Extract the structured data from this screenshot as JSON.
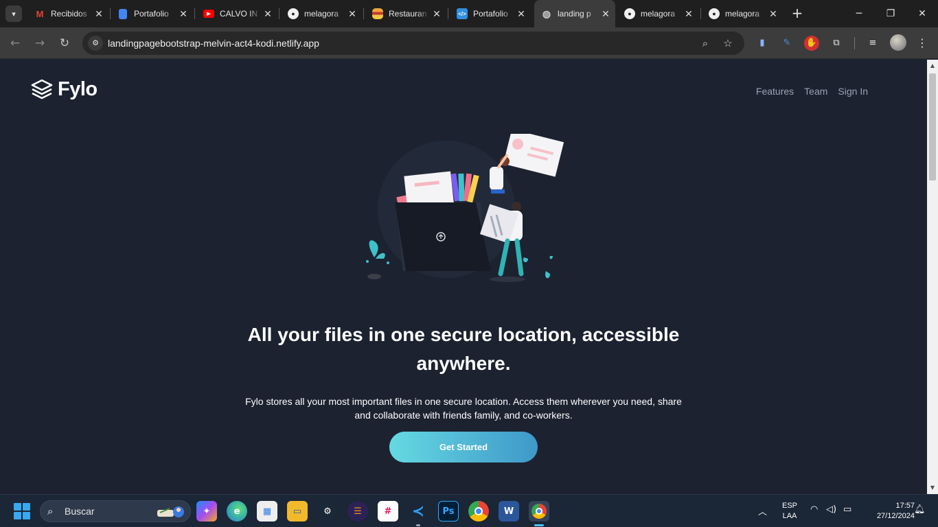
{
  "browser": {
    "tabs": [
      {
        "title": "Recibidos",
        "icon": "gmail-icon"
      },
      {
        "title": "Portafolio",
        "icon": "docs-icon"
      },
      {
        "title": "CALVO IN",
        "icon": "youtube-icon"
      },
      {
        "title": "melagora",
        "icon": "github-icon"
      },
      {
        "title": "Restauran",
        "icon": "burger-icon"
      },
      {
        "title": "Portafolio",
        "icon": "code-icon"
      },
      {
        "title": "landing p",
        "icon": "globe-icon",
        "active": true
      },
      {
        "title": "melagora",
        "icon": "github-icon"
      },
      {
        "title": "melagora",
        "icon": "github-icon"
      }
    ],
    "url": "landingpagebootstrap-melvin-act4-kodi.netlify.app",
    "colors": {
      "tabstrip": "#1f1f1f",
      "toolbar": "#3c3c3c",
      "omnibox": "#282828"
    }
  },
  "page": {
    "brand": "Fylo",
    "nav": [
      "Features",
      "Team",
      "Sign In"
    ],
    "hero_title": "All your files in one secure location, accessible anywhere.",
    "hero_text": "Fylo stores all your most important files in one secure location. Access them wherever you need, share and collaborate with friends family, and co-workers.",
    "cta": "Get Started",
    "colors": {
      "background": "#1c2230",
      "cta_start": "#65d9e2",
      "cta_end": "#3f98c9",
      "nav_link": "#9aa3b3"
    }
  },
  "taskbar": {
    "search_placeholder": "Buscar",
    "apps": [
      "copilot-icon",
      "edge-icon",
      "store-icon",
      "file-explorer-icon",
      "steam-icon",
      "eclipse-icon",
      "slack-icon",
      "vscode-icon",
      "photoshop-icon",
      "chrome-icon",
      "word-icon",
      "chrome-active-icon"
    ],
    "lang_top": "ESP",
    "lang_bottom": "LAA",
    "time": "17:57",
    "date": "27/12/2024"
  }
}
